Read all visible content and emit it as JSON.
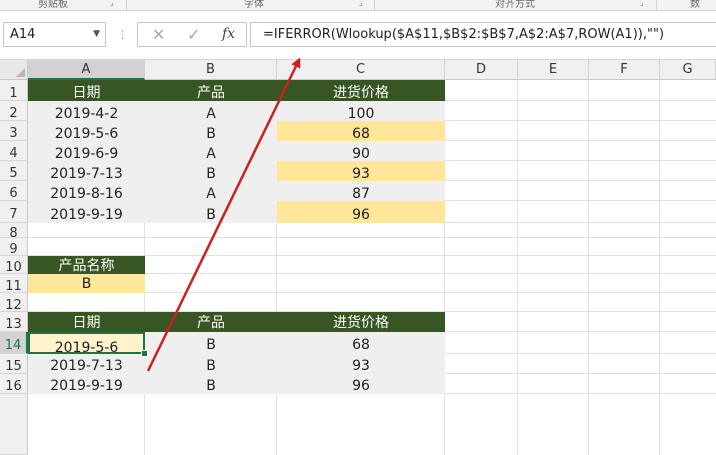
{
  "ribbon": {
    "groups": [
      "剪贴板",
      "字体",
      "对齐方式",
      "数"
    ]
  },
  "formula_bar": {
    "name_box": "A14",
    "cancel_icon": "✕",
    "enter_icon": "✓",
    "fx_label": "fx",
    "formula": "=IFERROR(Wlookup($A$11,$B$2:$B$7,A$2:A$7,ROW(A1)),\"\")"
  },
  "columns": [
    "A",
    "B",
    "C",
    "D",
    "E",
    "F",
    "G"
  ],
  "rows": [
    "1",
    "2",
    "3",
    "4",
    "5",
    "6",
    "7",
    "8",
    "9",
    "10",
    "11",
    "12",
    "13",
    "14",
    "15",
    "16"
  ],
  "source_table": {
    "headers": [
      "日期",
      "产品",
      "进货价格"
    ],
    "rows": [
      [
        "2019-4-2",
        "A",
        "100"
      ],
      [
        "2019-5-6",
        "B",
        "68"
      ],
      [
        "2019-6-9",
        "A",
        "90"
      ],
      [
        "2019-7-13",
        "B",
        "93"
      ],
      [
        "2019-8-16",
        "A",
        "87"
      ],
      [
        "2019-9-19",
        "B",
        "96"
      ]
    ]
  },
  "lookup": {
    "label": "产品名称",
    "value": "B"
  },
  "result_table": {
    "headers": [
      "日期",
      "产品",
      "进货价格"
    ],
    "rows": [
      [
        "2019-5-6",
        "B",
        "68"
      ],
      [
        "2019-7-13",
        "B",
        "93"
      ],
      [
        "2019-9-19",
        "B",
        "96"
      ]
    ]
  },
  "colors": {
    "header_green": "#375623",
    "highlight_yellow": "#ffe699",
    "active_cell": "#fff2cc",
    "selection_green": "#217346",
    "annotation_arrow": "#cc2020"
  }
}
